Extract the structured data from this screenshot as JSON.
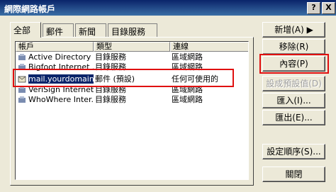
{
  "window": {
    "title": "網際網路帳戶"
  },
  "titlebar_buttons": {
    "help": "?",
    "close": "X"
  },
  "tabs": [
    {
      "label": "全部"
    },
    {
      "label": "郵件"
    },
    {
      "label": "新聞"
    },
    {
      "label": "目錄服務"
    }
  ],
  "list": {
    "columns": [
      "帳戶",
      "類型",
      "連線"
    ],
    "rows": [
      {
        "name": "Active Directory",
        "type": "目錄服務",
        "connection": "區域網路",
        "icon": "directory-service-icon"
      },
      {
        "name": "Bigfoot Internet ...",
        "type": "目錄服務",
        "connection": "區域網路",
        "icon": "directory-service-icon"
      },
      {
        "name": "mail.yourdomain....",
        "type": "郵件 (預設)",
        "connection": "任何可使用的",
        "icon": "mail-account-icon",
        "selected": true
      },
      {
        "name": "VeriSign Internet...",
        "type": "目錄服務",
        "connection": "區域網路",
        "icon": "directory-service-icon"
      },
      {
        "name": "WhoWhere Inter...",
        "type": "目錄服務",
        "connection": "區域網路",
        "icon": "directory-service-icon"
      }
    ]
  },
  "buttons": {
    "add": "新增(A)  ▶",
    "remove": "移除(R)",
    "properties": "內容(P)",
    "set_default": "設成預設值(D)",
    "import": "匯入(I)...",
    "export": "匯出(E)...",
    "set_order": "設定順序(S)...",
    "close": "關閉"
  },
  "colors": {
    "highlight": "#e01010",
    "selection": "#0a246a"
  }
}
